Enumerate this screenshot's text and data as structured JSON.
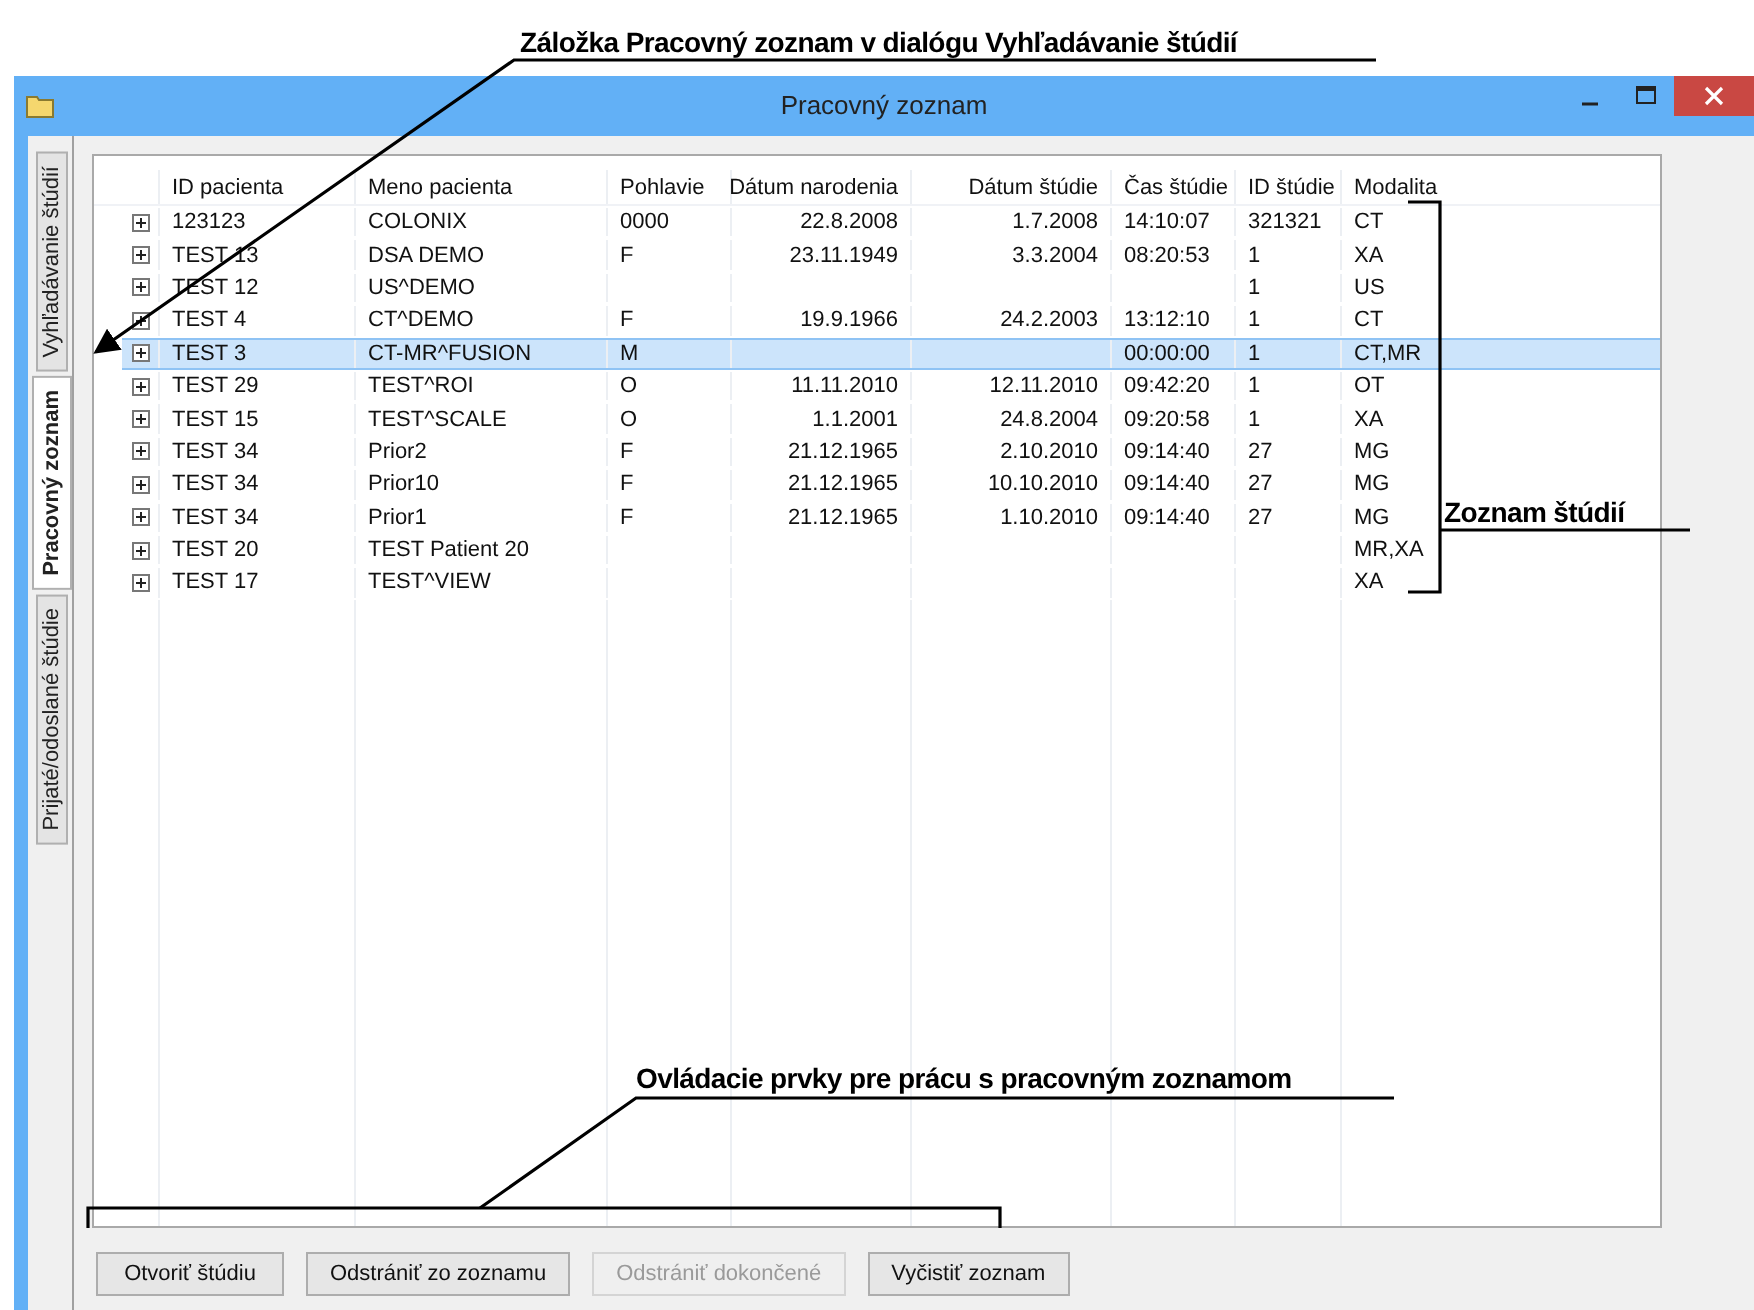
{
  "window": {
    "title": "Pracovný zoznam"
  },
  "tabs": [
    {
      "label": "Vyhľadávanie štúdií",
      "selected": false
    },
    {
      "label": "Pracovný zoznam",
      "selected": true
    },
    {
      "label": "Prijaté/odoslané štúdie",
      "selected": false
    }
  ],
  "table": {
    "columns": [
      "ID pacienta",
      "Meno pacienta",
      "Pohlavie",
      "Dátum narodenia",
      "Dátum štúdie",
      "Čas štúdie",
      "ID štúdie",
      "Modalita"
    ],
    "rows": [
      {
        "selected": false,
        "cells": [
          "123123",
          "COLONIX",
          "0000",
          "22.8.2008",
          "1.7.2008",
          "14:10:07",
          "321321",
          "CT"
        ]
      },
      {
        "selected": false,
        "cells": [
          "TEST 13",
          "DSA DEMO",
          "F",
          "23.11.1949",
          "3.3.2004",
          "08:20:53",
          "1",
          "XA"
        ]
      },
      {
        "selected": false,
        "cells": [
          "TEST 12",
          "US^DEMO",
          "",
          "",
          "",
          "",
          "1",
          "US"
        ]
      },
      {
        "selected": false,
        "cells": [
          "TEST 4",
          "CT^DEMO",
          "F",
          "19.9.1966",
          "24.2.2003",
          "13:12:10",
          "1",
          "CT"
        ]
      },
      {
        "selected": true,
        "cells": [
          "TEST 3",
          "CT-MR^FUSION",
          "M",
          "",
          "",
          "00:00:00",
          "1",
          "CT,MR"
        ]
      },
      {
        "selected": false,
        "cells": [
          "TEST 29",
          "TEST^ROI",
          "O",
          "11.11.2010",
          "12.11.2010",
          "09:42:20",
          "1",
          "OT"
        ]
      },
      {
        "selected": false,
        "cells": [
          "TEST 15",
          "TEST^SCALE",
          "O",
          "1.1.2001",
          "24.8.2004",
          "09:20:58",
          "1",
          "XA"
        ]
      },
      {
        "selected": false,
        "cells": [
          "TEST 34",
          "Prior2",
          "F",
          "21.12.1965",
          "2.10.2010",
          "09:14:40",
          "27",
          "MG"
        ]
      },
      {
        "selected": false,
        "cells": [
          "TEST 34",
          "Prior10",
          "F",
          "21.12.1965",
          "10.10.2010",
          "09:14:40",
          "27",
          "MG"
        ]
      },
      {
        "selected": false,
        "cells": [
          "TEST 34",
          "Prior1",
          "F",
          "21.12.1965",
          "1.10.2010",
          "09:14:40",
          "27",
          "MG"
        ]
      },
      {
        "selected": false,
        "cells": [
          "TEST 20",
          "TEST Patient 20",
          "",
          "",
          "",
          "",
          "",
          "MR,XA"
        ]
      },
      {
        "selected": false,
        "cells": [
          "TEST 17",
          "TEST^VIEW",
          "",
          "",
          "",
          "",
          "",
          "XA"
        ]
      }
    ]
  },
  "buttons": [
    {
      "label": "Otvoriť štúdiu",
      "disabled": false
    },
    {
      "label": "Odstrániť zo zoznamu",
      "disabled": false
    },
    {
      "label": "Odstrániť dokončené",
      "disabled": true
    },
    {
      "label": "Vyčistiť zoznam",
      "disabled": false
    }
  ],
  "annotations": [
    "Záložka Pracovný zoznam v dialógu Vyhľadávanie štúdií",
    "Zoznam štúdií",
    "Ovládacie prvky pre prácu s pracovným zoznamom"
  ]
}
